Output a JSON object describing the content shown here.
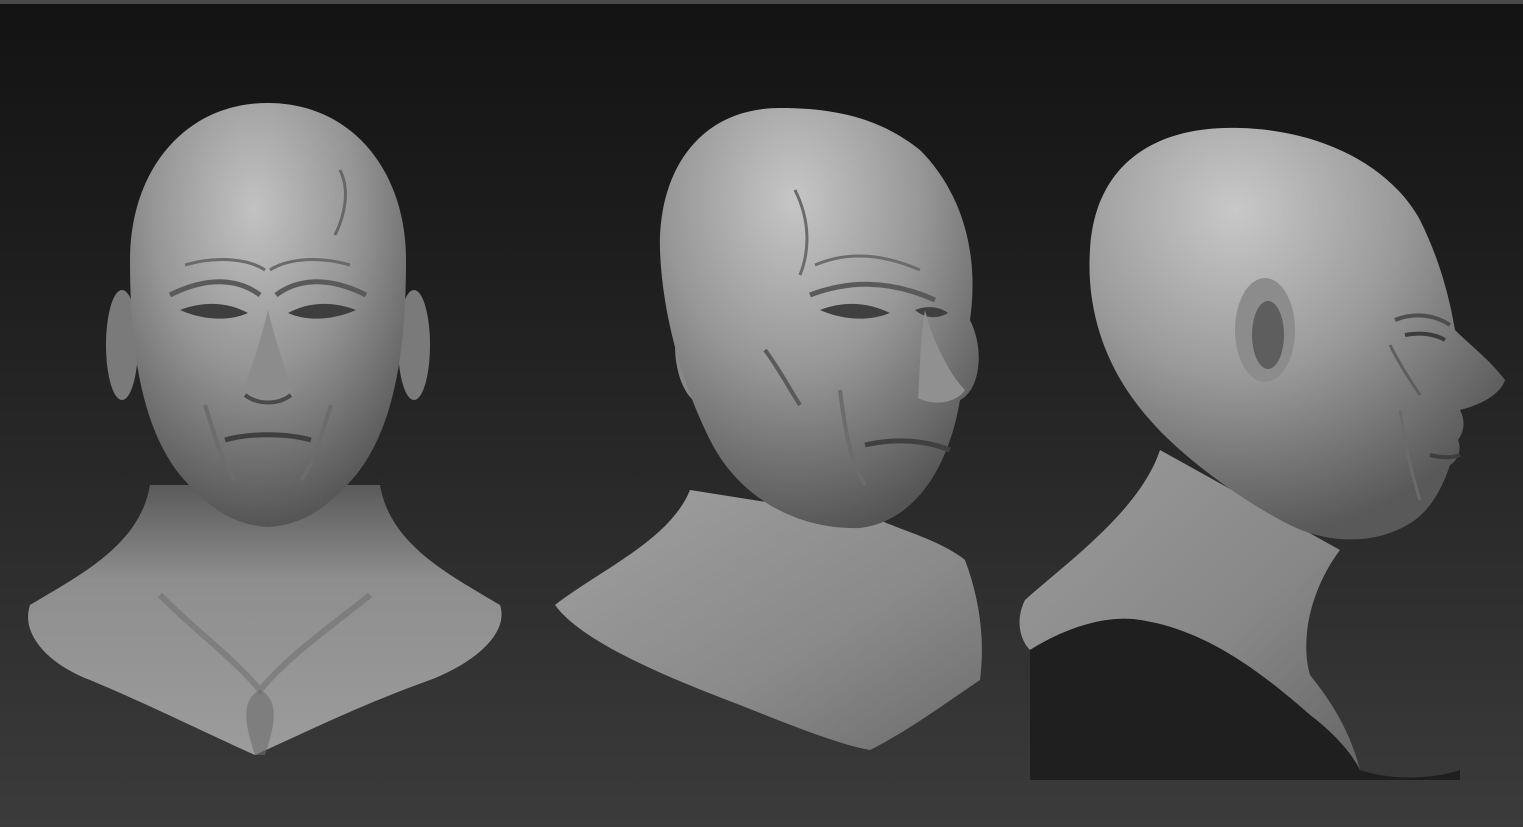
{
  "viewport": {
    "background_top": "#141414",
    "background_bottom": "#3a3a3a",
    "clay_color": "#8a8a8a",
    "clay_highlight": "#c4c4c4",
    "clay_shadow": "#3e3e3e"
  },
  "views": [
    {
      "id": "front"
    },
    {
      "id": "three-quarter"
    },
    {
      "id": "profile"
    }
  ]
}
